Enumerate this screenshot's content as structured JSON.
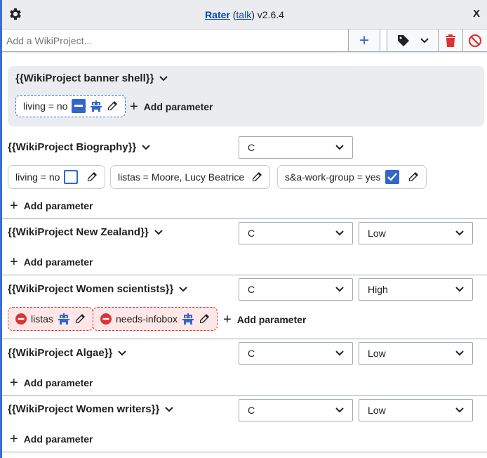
{
  "titlebar": {
    "app_name": "Rater",
    "talk_label": "talk",
    "version": "v2.6.4",
    "close_label": "X"
  },
  "toolbar": {
    "add_placeholder": "Add a WikiProject...",
    "add_button": "+"
  },
  "banner_shell": {
    "name": "{{WikiProject banner shell}}",
    "params": [
      {
        "text": "living = no",
        "control": "checkbox-indeterminate"
      }
    ],
    "add_param_label": "Add parameter"
  },
  "banners": [
    {
      "name": "{{WikiProject Biography}}",
      "class": "C",
      "importance": null,
      "params": [
        {
          "text": "living = no",
          "control": "checkbox"
        },
        {
          "text": "listas = Moore, Lucy Beatrice",
          "control": "none"
        },
        {
          "text": "s&a-work-group = yes",
          "control": "checkbox-checked"
        }
      ],
      "add_param_label": "Add parameter"
    },
    {
      "name": "{{WikiProject New Zealand}}",
      "class": "C",
      "importance": "Low",
      "params": [],
      "add_param_label": "Add parameter"
    },
    {
      "name": "{{WikiProject Women scientists}}",
      "class": "C",
      "importance": "High",
      "params": [
        {
          "text": "listas",
          "control": "invalid"
        },
        {
          "text": "needs-infobox",
          "control": "invalid"
        }
      ],
      "add_param_label": "Add parameter"
    },
    {
      "name": "{{WikiProject Algae}}",
      "class": "C",
      "importance": "Low",
      "params": [],
      "add_param_label": "Add parameter"
    },
    {
      "name": "{{WikiProject Women writers}}",
      "class": "C",
      "importance": "Low",
      "params": [],
      "add_param_label": "Add parameter"
    }
  ],
  "colors": {
    "accent": "#3366cc",
    "danger": "#d33333",
    "panel": "#eaecf0",
    "frame": "#3a6fd8"
  }
}
